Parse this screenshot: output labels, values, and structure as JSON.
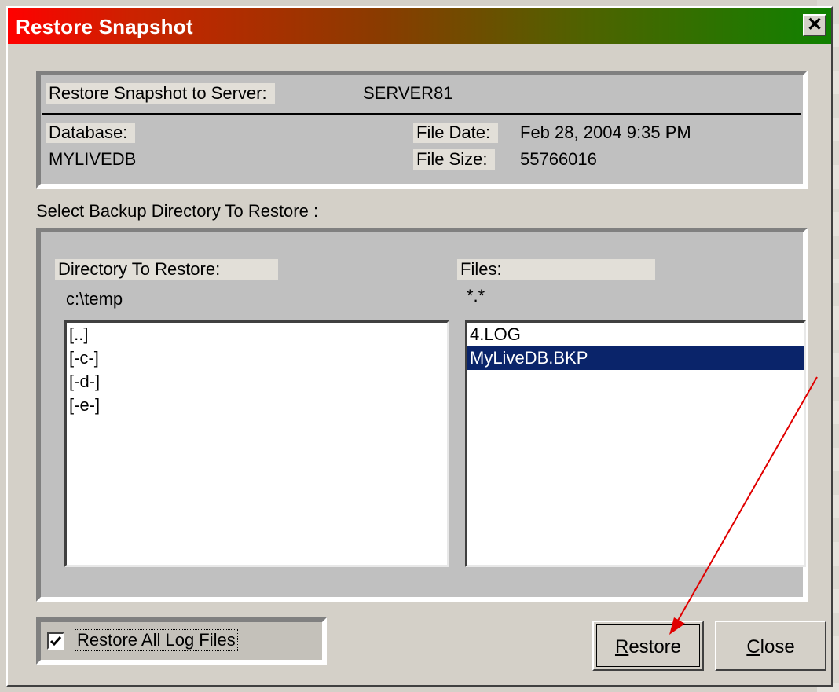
{
  "window": {
    "title": "Restore Snapshot",
    "close_glyph": "✕"
  },
  "summary": {
    "server_label": "Restore Snapshot to Server:",
    "server_value": "SERVER81",
    "database_label": "Database:",
    "database_value": "MYLIVEDB",
    "file_date_label": "File Date:",
    "file_date_value": "Feb 28, 2004 9:35 PM",
    "file_size_label": "File Size:",
    "file_size_value": "55766016"
  },
  "select_label": "Select Backup Directory To Restore :",
  "browser": {
    "directory_label": "Directory To Restore:",
    "directory_value": "c:\\temp",
    "files_label": "Files:",
    "files_filter": "*.*",
    "directories": [
      "[..]",
      "[-c-]",
      "[-d-]",
      "[-e-]"
    ],
    "files": [
      "4.LOG",
      "MyLiveDB.BKP"
    ],
    "selected_file": "MyLiveDB.BKP"
  },
  "options": {
    "restore_all_logs_label": "Restore All Log Files",
    "restore_all_logs_checked": true
  },
  "buttons": {
    "restore_mnemonic": "R",
    "restore_rest": "estore",
    "close_mnemonic": "C",
    "close_rest": "lose"
  },
  "colors": {
    "selection": "#0a246a",
    "annotation_arrow": "#e00000"
  }
}
